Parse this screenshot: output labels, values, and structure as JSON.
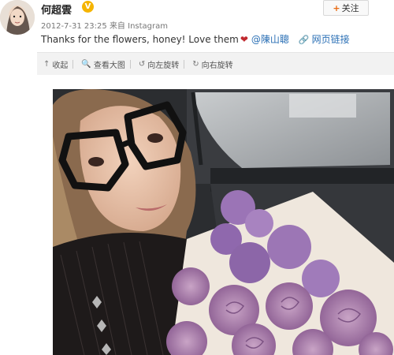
{
  "user": {
    "name": "何超雲",
    "badge": "V",
    "timestamp": "2012-7-31 23:25",
    "source": "来自 Instagram",
    "follow_label": "关注"
  },
  "post": {
    "text": "Thanks for the flowers, honey! Love them",
    "mention": "@陳山聰",
    "link_label": "网页链接"
  },
  "toolbar": {
    "collapse": "收起",
    "view_large": "查看大图",
    "rotate_left": "向左旋转",
    "rotate_right": "向右旋转"
  },
  "icons": {
    "collapse": "up-arrow-icon",
    "view_large": "magnifier-icon",
    "rotate_left": "rotate-left-icon",
    "rotate_right": "rotate-right-icon",
    "link": "link-icon",
    "heart": "heart-icon"
  },
  "colors": {
    "link": "#2a6fb5",
    "follow_plus": "#e9690f",
    "verified": "#f5b400",
    "heart": "#c0292f",
    "toolbar_bg": "#f2f2f2"
  }
}
